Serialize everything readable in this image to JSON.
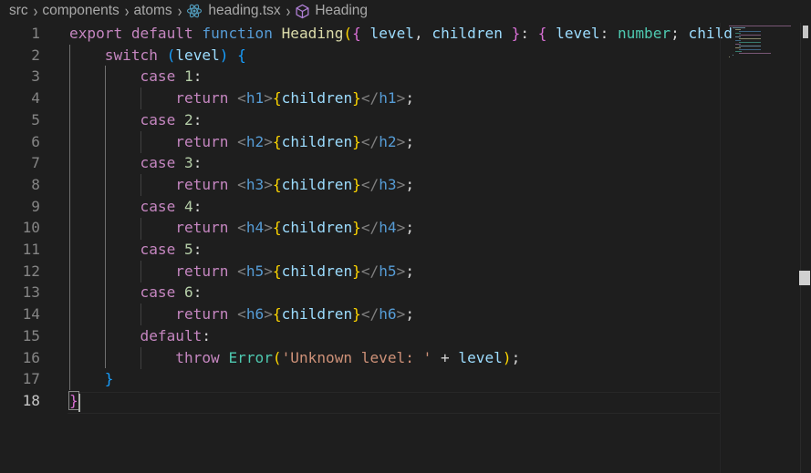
{
  "breadcrumb": {
    "items": [
      "src",
      "components",
      "atoms",
      "heading.tsx",
      "Heading"
    ]
  },
  "editor": {
    "language": "tsx",
    "active_line": "18",
    "line_numbers": [
      "1",
      "2",
      "3",
      "4",
      "5",
      "6",
      "7",
      "8",
      "9",
      "10",
      "11",
      "12",
      "13",
      "14",
      "15",
      "16",
      "17",
      "18"
    ],
    "lines": [
      "export default function Heading({ level, children }: { level: number; child",
      "    switch (level) {",
      "        case 1:",
      "            return <h1>{children}</h1>;",
      "        case 2:",
      "            return <h2>{children}</h2>;",
      "        case 3:",
      "            return <h3>{children}</h3>;",
      "        case 4:",
      "            return <h4>{children}</h4>;",
      "        case 5:",
      "            return <h5>{children}</h5>;",
      "        case 6:",
      "            return <h6>{children}</h6>;",
      "        default:",
      "            throw Error('Unknown level: ' + level);",
      "    }",
      "}"
    ]
  },
  "colors": {
    "background": "#1e1e1e",
    "control_keyword": "#c586c0",
    "storage_keyword": "#569cd6",
    "function": "#dcdcaa",
    "variable": "#9cdcfe",
    "type": "#4ec9b0",
    "number": "#b5cea8",
    "string": "#ce9178",
    "bracket_level1": "#ffd700",
    "bracket_level2": "#da70d6",
    "bracket_level3": "#179fff",
    "react_icon": "#519aba",
    "symbol_icon": "#b180d7"
  },
  "icons": {
    "file_icon": "react-icon",
    "symbol_icon": "cube-icon",
    "separator": "chevron-right-icon"
  }
}
